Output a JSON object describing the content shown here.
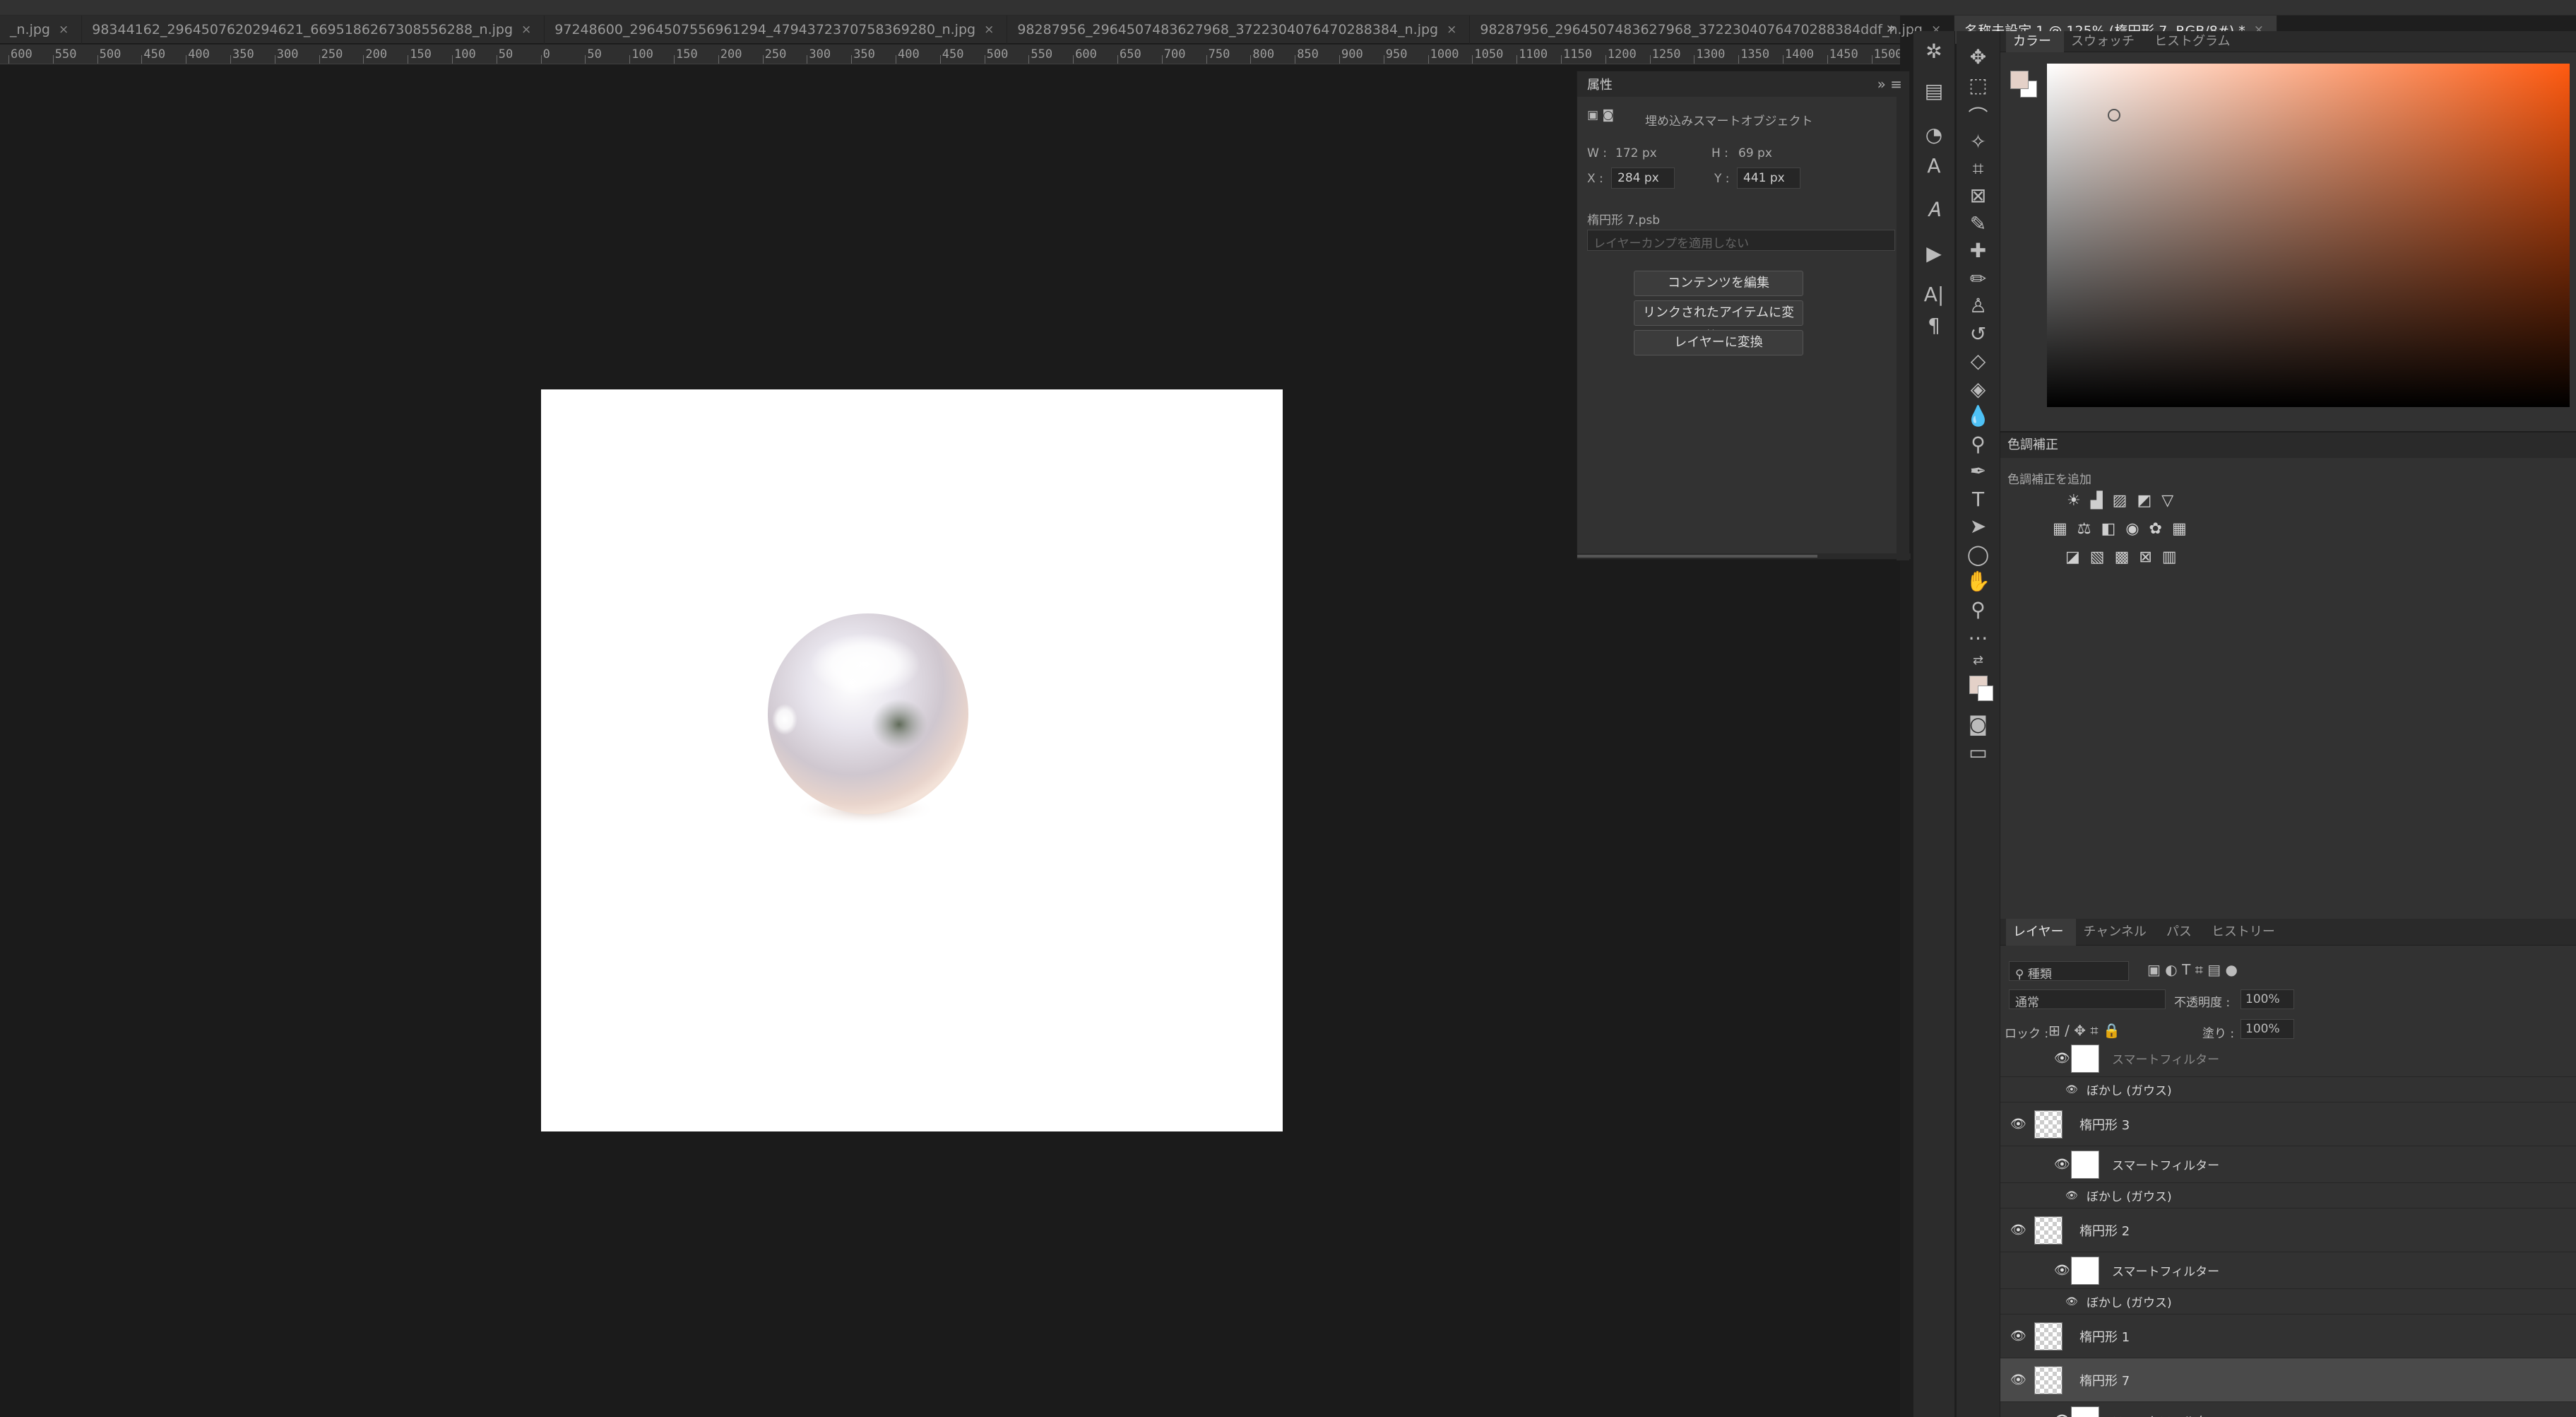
{
  "tabs": [
    {
      "label": "_n.jpg"
    },
    {
      "label": "98344162_2964507620294621_6695186267308556288_n.jpg"
    },
    {
      "label": "97248600_2964507556961294_4794372370758369280_n.jpg"
    },
    {
      "label": "98287956_2964507483627968_3722304076470288384_n.jpg"
    },
    {
      "label": "98287956_2964507483627968_3722304076470288384ddf_n.jpg"
    },
    {
      "label": "名称未設定 1 @ 125% (楕円形 7, RGB/8#) *",
      "active": true
    }
  ],
  "tab_overflow": "»",
  "ruler": {
    "labels": [
      "600",
      "550",
      "500",
      "450",
      "400",
      "350",
      "300",
      "250",
      "200",
      "150",
      "100",
      "50",
      "0",
      "50",
      "100",
      "150",
      "200",
      "250",
      "300",
      "350",
      "400",
      "450",
      "500",
      "550",
      "600",
      "650",
      "700",
      "750",
      "800",
      "850",
      "900",
      "950",
      "1000",
      "1050",
      "1100",
      "1150",
      "1200",
      "1250",
      "1300",
      "1350",
      "1400",
      "1450",
      "1500"
    ]
  },
  "properties": {
    "title": "属性",
    "object_type": "埋め込みスマートオブジェクト",
    "w_label": "W :",
    "w_value": "172 px",
    "h_label": "H :",
    "h_value": "69 px",
    "x_label": "X :",
    "x_value": "284 px",
    "y_label": "Y :",
    "y_value": "441 px",
    "filename": "楕円形 7.psb",
    "layer_comp": "レイヤーカンプを適用しない",
    "btn_edit": "コンテンツを編集",
    "btn_convert_linked": "リンクされたアイテムに変換...",
    "btn_convert_layer": "レイヤーに変換"
  },
  "color_panel": {
    "tabs": [
      "カラー",
      "スウォッチ",
      "ヒストグラム"
    ],
    "fg_color": "#e4d1c8",
    "bg_color": "#ffffff"
  },
  "adjustments": {
    "title": "色調補正",
    "add_label": "色調補正を追加"
  },
  "layers": {
    "tabs": [
      "レイヤー",
      "チャンネル",
      "パス",
      "ヒストリー"
    ],
    "filter_kind": "種類",
    "blend_mode": "通常",
    "opacity_label": "不透明度 :",
    "opacity_value": "100%",
    "lock_label": "ロック :",
    "fill_label": "塗り :",
    "fill_value": "100%",
    "rows": [
      {
        "name": "スマートフィルター",
        "type": "filter-partial"
      },
      {
        "name": "ぼかし (ガウス)",
        "type": "effect"
      },
      {
        "name": "楕円形 3",
        "type": "layer"
      },
      {
        "name": "スマートフィルター",
        "type": "filter"
      },
      {
        "name": "ぼかし (ガウス)",
        "type": "effect"
      },
      {
        "name": "楕円形 2",
        "type": "layer"
      },
      {
        "name": "スマートフィルター",
        "type": "filter"
      },
      {
        "name": "ぼかし (ガウス)",
        "type": "effect"
      },
      {
        "name": "楕円形 1",
        "type": "layer"
      },
      {
        "name": "楕円形 7",
        "type": "layer",
        "selected": true
      },
      {
        "name": "スマートフィルター",
        "type": "filter"
      }
    ]
  }
}
